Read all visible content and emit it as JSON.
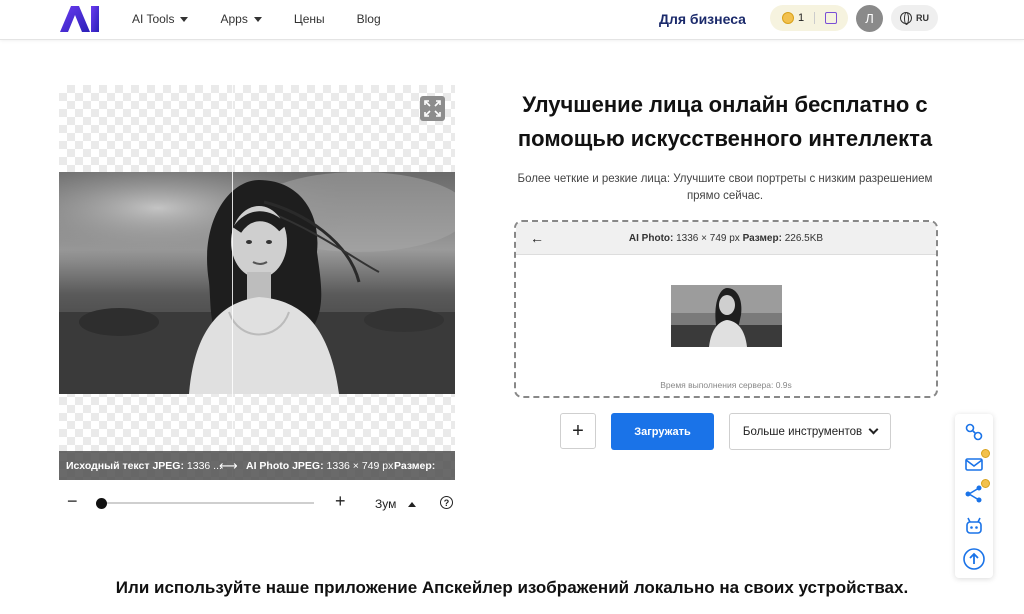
{
  "header": {
    "logo_text": "AI",
    "nav": [
      {
        "label": "AI Tools",
        "has_dropdown": true
      },
      {
        "label": "Apps",
        "has_dropdown": true
      },
      {
        "label": "Цены",
        "has_dropdown": false
      },
      {
        "label": "Blog",
        "has_dropdown": false
      }
    ],
    "business_link": "Для бизнеса",
    "coins_count": "1",
    "avatar_letter": "Л",
    "language": "RU"
  },
  "preview": {
    "info_left_label": "Исходный текст JPEG:",
    "info_left_value": "1336 ...",
    "info_right_label": "AI Photo JPEG:",
    "info_right_value": "1336 × 749 px",
    "info_right2_label": "Размер:",
    "compare_arrows": "⟷",
    "zoom_label": "Зум",
    "zoom_level": 0.0
  },
  "main": {
    "title": "Улучшение лица онлайн бесплатно с помощью искусственного интеллекта",
    "subtitle": "Более четкие и резкие лица: Улучшите свои портреты с низким разрешением прямо сейчас.",
    "result": {
      "label": "AI Photo:",
      "dimensions": "1336 × 749 px",
      "size_label": "Размер:",
      "size_value": "226.5KB",
      "exec_time": "Время выполнения сервера: 0.9s"
    },
    "upload_button": "Загружать",
    "more_tools_button": "Больше инструментов"
  },
  "footer_text": "Или используйте наше приложение Апскейлер изображений локально на своих устройствах.",
  "colors": {
    "accent": "#1a73e8",
    "brand_logo": "#3f2bd8",
    "business_text": "#1b2a6b",
    "side_icons": "#1a73e8"
  },
  "icons": [
    "expand-icon",
    "back-arrow-icon",
    "plus-icon",
    "chevron-down-icon",
    "help-icon",
    "share-icon",
    "mail-icon",
    "link-icon",
    "robot-icon",
    "arrow-up-icon",
    "calendar-icon",
    "coin-icon",
    "globe-icon"
  ]
}
